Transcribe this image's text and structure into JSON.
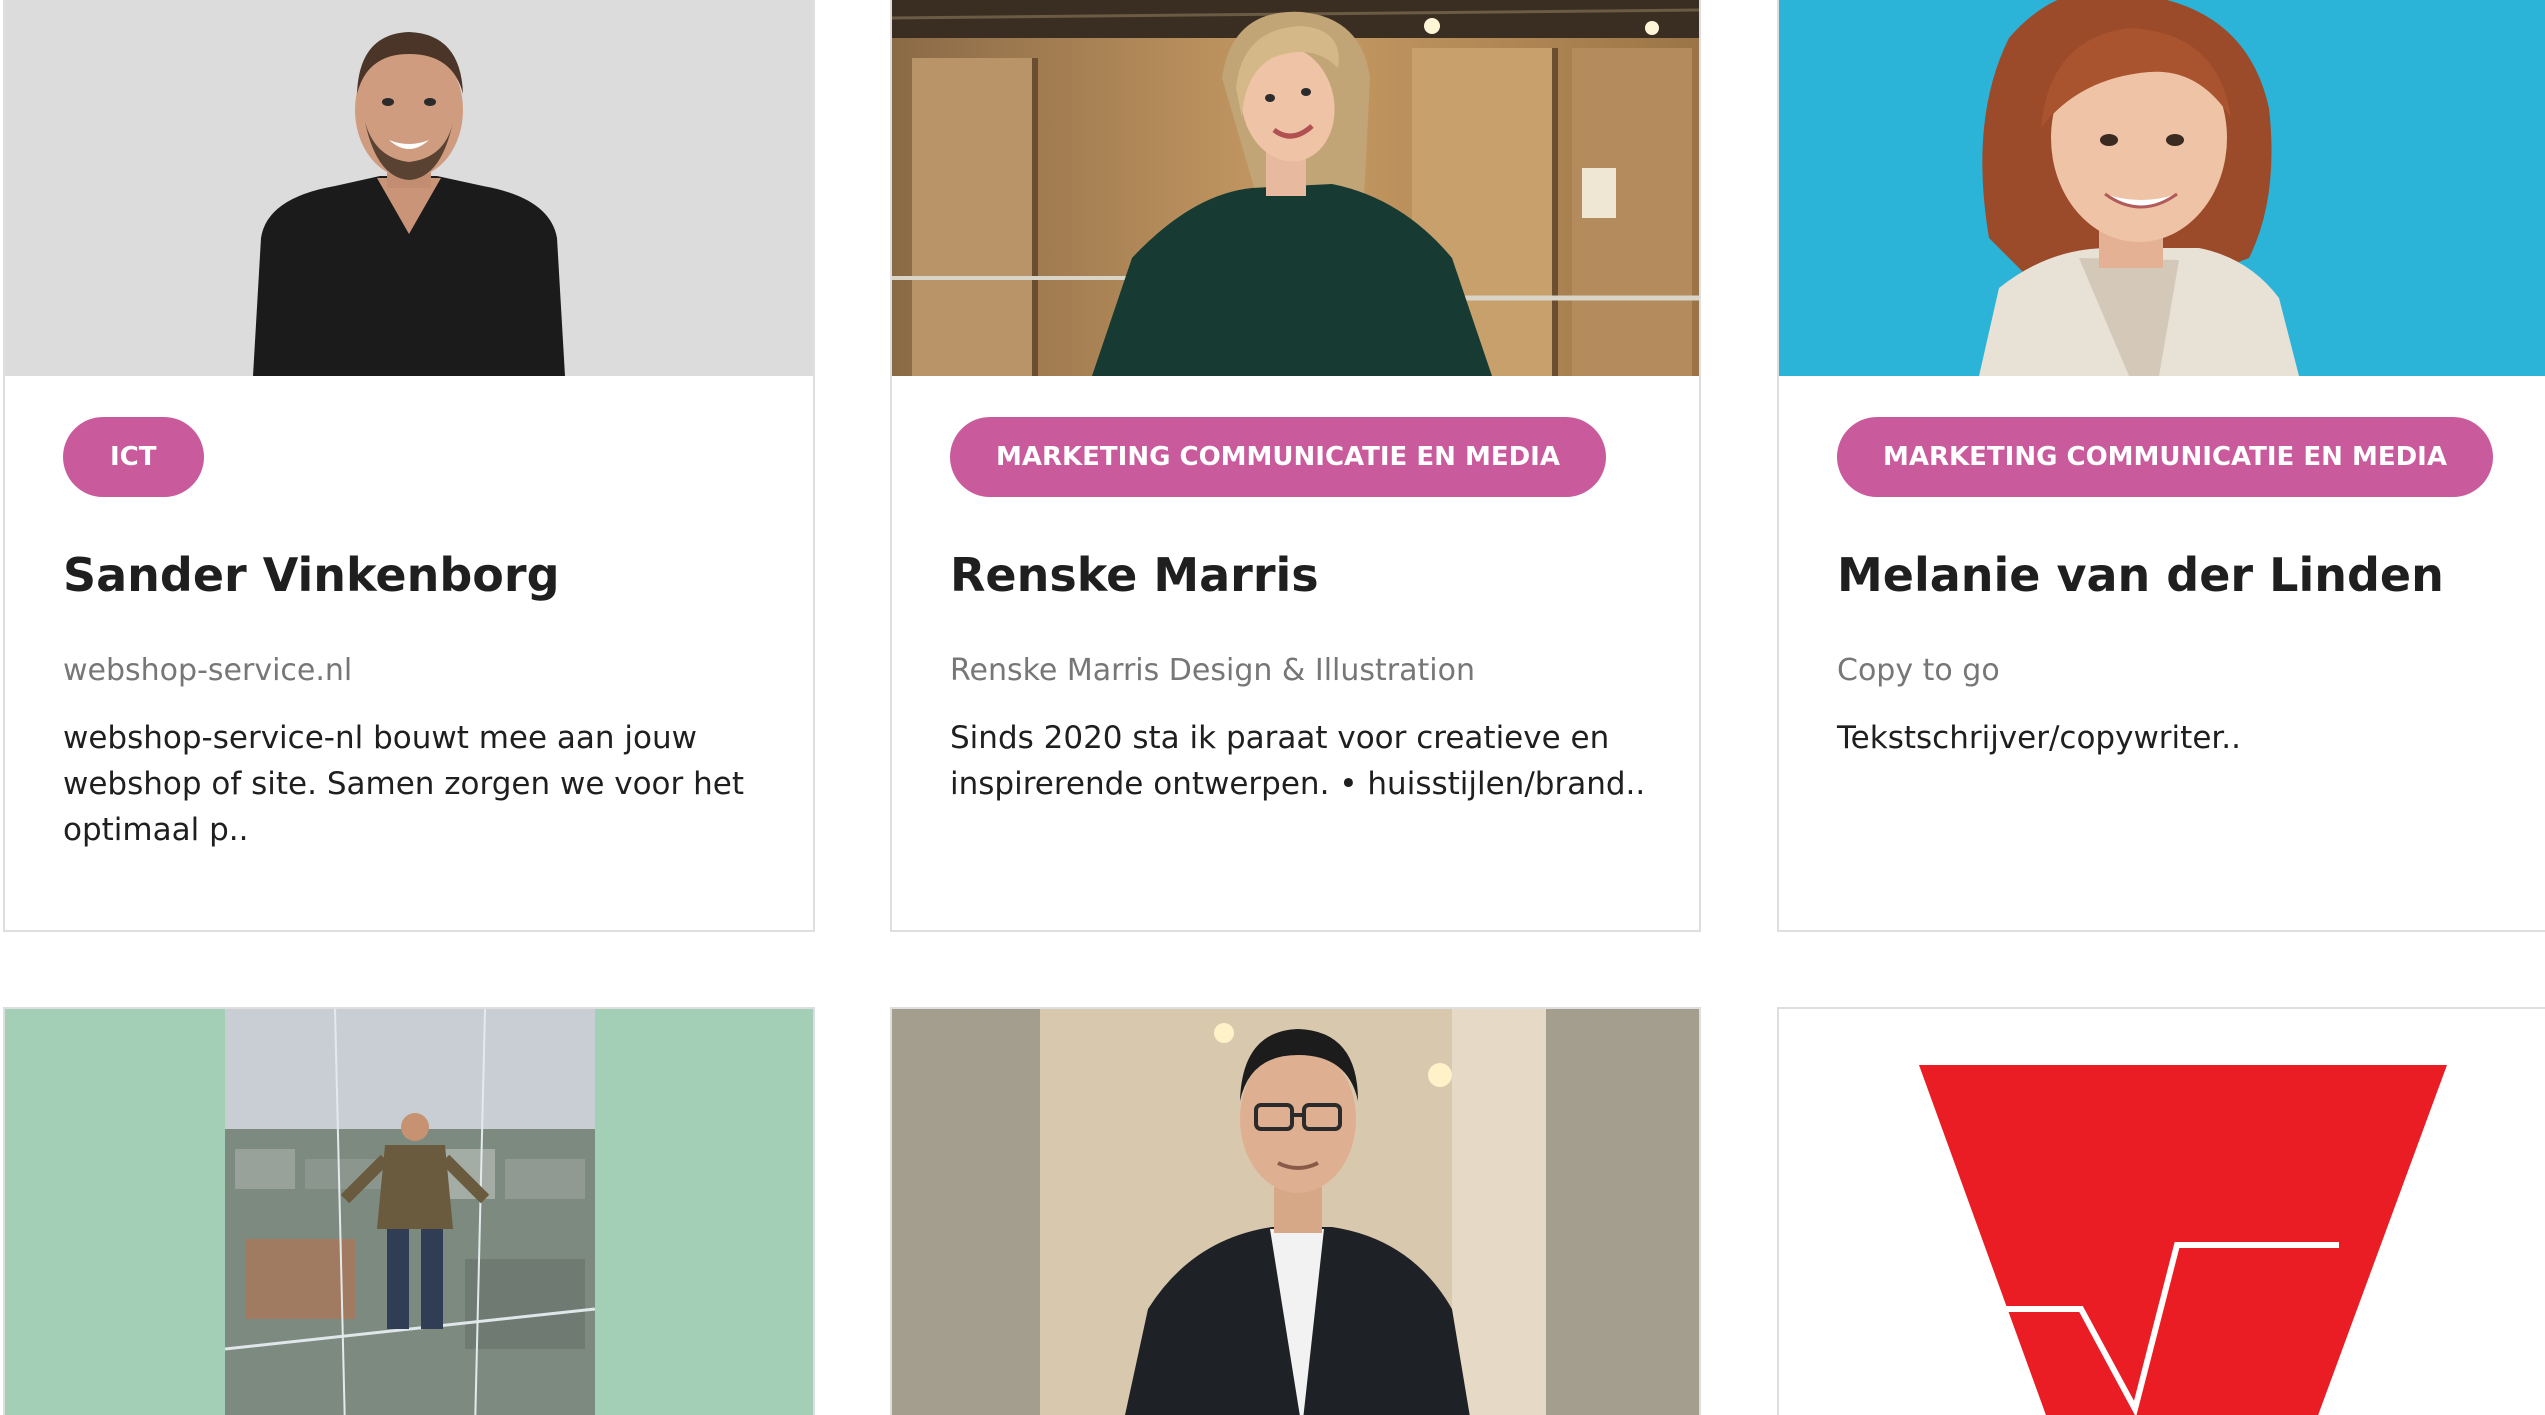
{
  "colors": {
    "badge": "#c95a9c",
    "card_border": "#dedede",
    "company_text": "#777777"
  },
  "cards": [
    {
      "category": "ICT",
      "name": "Sander Vinkenborg",
      "company": "webshop-service.nl",
      "description": "webshop-service-nl bouwt mee aan jouw webshop of site. Samen zorgen we voor het optimaal p.."
    },
    {
      "category": "MARKETING COMMUNICATIE EN MEDIA",
      "name": "Renske Marris",
      "company": "Renske Marris Design & Illustration",
      "description": "Sinds 2020 sta ik paraat voor creatieve en inspirerende ontwerpen. • huisstijlen/brand.."
    },
    {
      "category": "MARKETING COMMUNICATIE EN MEDIA",
      "name": "Melanie van der Linden",
      "company": "Copy to go",
      "description": "Tekstschrijver/copywriter.."
    }
  ]
}
